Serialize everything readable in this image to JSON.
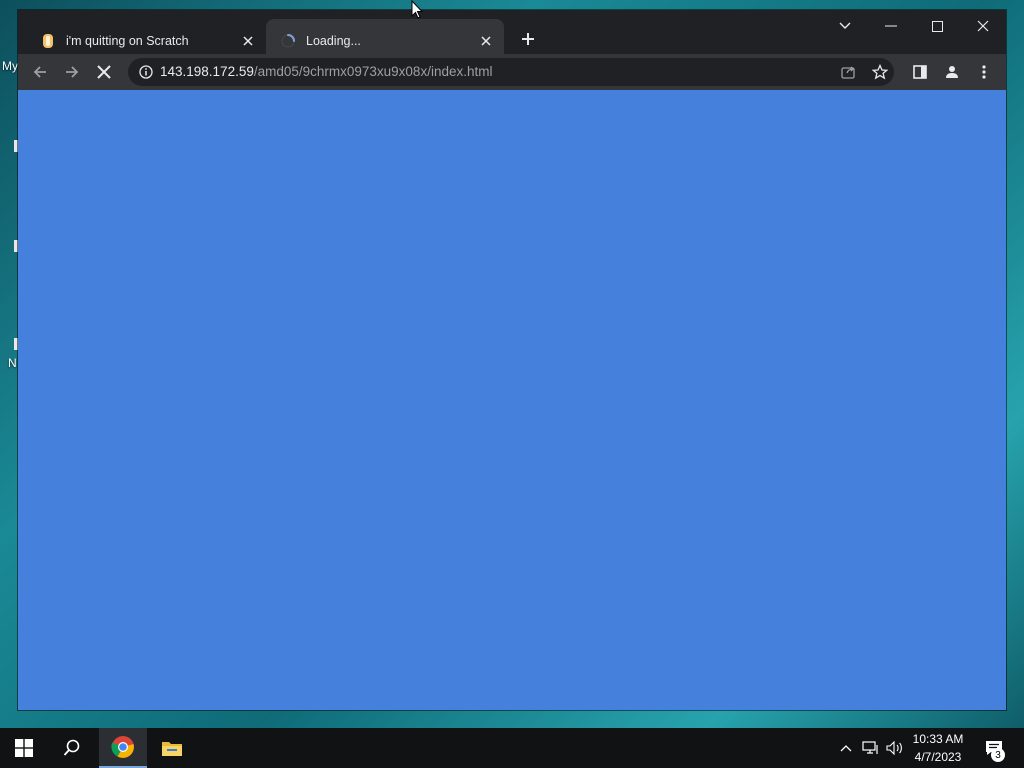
{
  "desktop": {
    "label_my": "My",
    "label_n": "N"
  },
  "browser": {
    "tabs": [
      {
        "title": "i'm quitting on Scratch",
        "favicon": "scratch-favicon"
      },
      {
        "title": "Loading...",
        "favicon": "loading-spinner"
      }
    ],
    "url_host": "143.198.172.59",
    "url_path": "/amd05/9chrmx0973xu9x08x/index.html",
    "page_background": "#4480dc"
  },
  "taskbar": {
    "time": "10:33 AM",
    "date": "4/7/2023",
    "notification_count": "3"
  }
}
